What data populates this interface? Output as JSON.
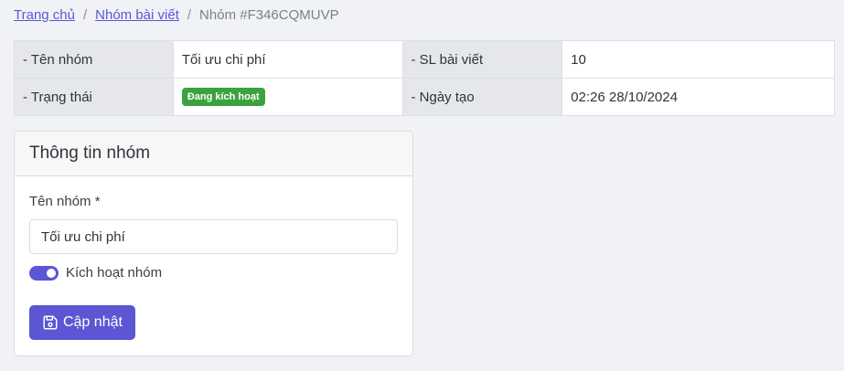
{
  "breadcrumb": {
    "home": "Trang chủ",
    "groups": "Nhóm bài viết",
    "current": "Nhóm #F346CQMUVP",
    "separator": "/"
  },
  "info": {
    "name_label": "- Tên nhóm",
    "name_value": "Tối ưu chi phí",
    "count_label": "- SL bài viết",
    "count_value": "10",
    "status_label": "- Trạng thái",
    "status_value": "Đang kích hoạt",
    "created_label": "- Ngày tạo",
    "created_value": "02:26 28/10/2024"
  },
  "card": {
    "title": "Thông tin nhóm",
    "name_field_label": "Tên nhóm *",
    "name_field_value": "Tối ưu chi phí",
    "toggle_label": "Kích hoạt nhóm",
    "toggle_on": true,
    "update_button": "Cập nhật"
  },
  "colors": {
    "accent": "#5a56d4",
    "status_green": "#3aa23e"
  },
  "icons": {
    "update_button": "save-icon"
  }
}
